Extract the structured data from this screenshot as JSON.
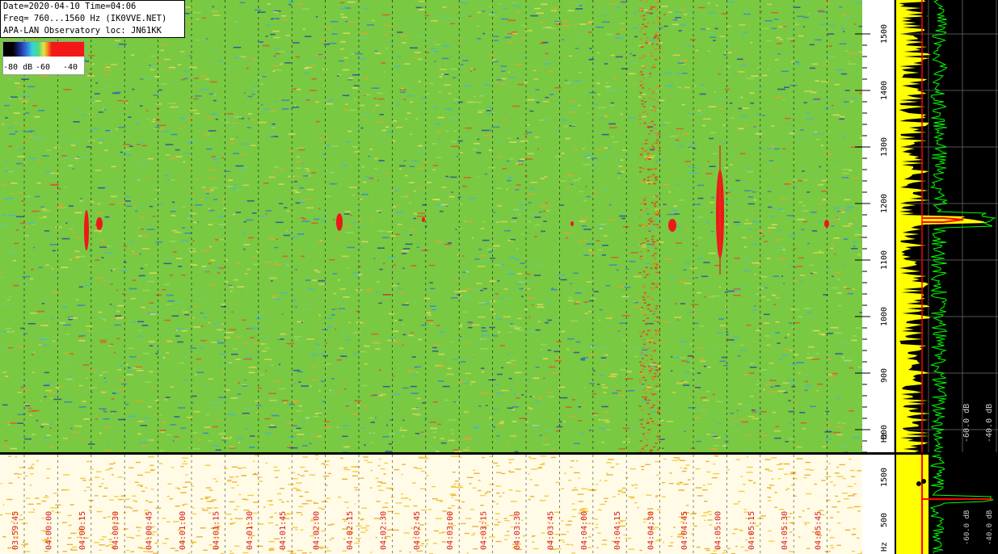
{
  "info": {
    "line1": "Date=2020-04-10 Time=04:06",
    "line2": "Freq= 760...1560 Hz (IK0VVE.NET)",
    "line3": "APA-LAN Observatory loc: JN61KK"
  },
  "legend": {
    "label_min": "-80 dB",
    "label_mid": "-60",
    "label_max": "-40"
  },
  "freq_axis": {
    "ticks": [
      "1500",
      "1400",
      "1300",
      "1200",
      "1100",
      "1000",
      "900",
      "800"
    ],
    "unit": "Hz"
  },
  "lower_freq_axis": {
    "ticks": [
      "1500",
      "500"
    ],
    "unit": "Hz"
  },
  "spectrum_axis": {
    "labels": [
      "-60.0 dB",
      "-40.0 dB"
    ]
  },
  "lower_spectrum_axis": {
    "labels": [
      "-60.0 dB",
      "-40.0 dB"
    ]
  },
  "time_axis": {
    "labels": [
      "03:59:45",
      "04:00:00",
      "04:00:15",
      "04:00:30",
      "04:00:45",
      "04:01:00",
      "04:01:15",
      "04:01:30",
      "04:01:45",
      "04:02:00",
      "04:02:15",
      "04:02:30",
      "04:02:45",
      "04:03:00",
      "04:03:15",
      "04:03:30",
      "04:03:45",
      "04:04:00",
      "04:04:15",
      "04:04:30",
      "04:04:45",
      "04:05:00",
      "04:05:15",
      "04:05:30",
      "04:05:45"
    ]
  },
  "colors": {
    "background": "#7ac943",
    "trace_yellow": "#ffff00",
    "trace_green": "#00ff00",
    "trace_red": "#ff0000",
    "time_label": "#d81818"
  }
}
